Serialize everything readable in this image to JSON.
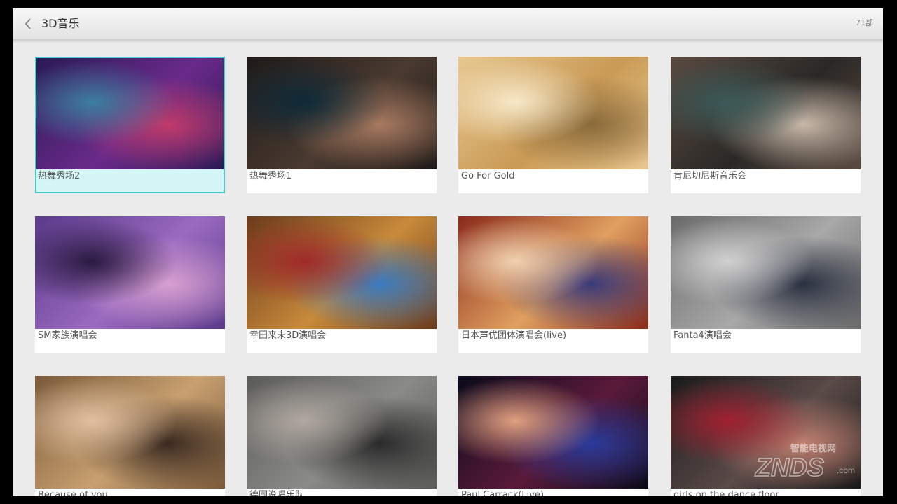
{
  "header": {
    "back_icon": "chevron-left-icon",
    "title": "3D音乐",
    "count": "71部"
  },
  "items": [
    {
      "caption": "热舞秀场2",
      "selected": true,
      "palette": [
        "#2a1a55",
        "#6a2a8a",
        "#c03a6a",
        "#3c7fa0"
      ]
    },
    {
      "caption": "热舞秀场1",
      "selected": false,
      "palette": [
        "#1e1a18",
        "#4a3a30",
        "#a87a60",
        "#0e2a38"
      ]
    },
    {
      "caption": "Go For Gold",
      "selected": false,
      "palette": [
        "#e8c890",
        "#c99a55",
        "#8a6a3a",
        "#f6e8c8"
      ]
    },
    {
      "caption": "肯尼切尼斯音乐会",
      "selected": false,
      "palette": [
        "#5a4a40",
        "#2a2826",
        "#c8b8a8",
        "#3a5a58"
      ]
    },
    {
      "caption": "SM家族演唱会",
      "selected": false,
      "palette": [
        "#5a3a8a",
        "#9a6ac0",
        "#d8a0d0",
        "#2a1a40"
      ]
    },
    {
      "caption": "幸田来未3D演唱会",
      "selected": false,
      "palette": [
        "#6a3a1a",
        "#c88a3a",
        "#3a7ac0",
        "#a02a2a"
      ]
    },
    {
      "caption": "日本声优团体演唱会(live)",
      "selected": false,
      "palette": [
        "#8a2a1a",
        "#e0a060",
        "#3a3a7a",
        "#f0d0b0"
      ]
    },
    {
      "caption": "Fanta4演唱会",
      "selected": false,
      "palette": [
        "#6a6a6a",
        "#a8a8a8",
        "#2a3040",
        "#d0d0d0"
      ]
    },
    {
      "caption": "Because of you",
      "selected": false,
      "palette": [
        "#7a5a3a",
        "#c8a070",
        "#3a2a20",
        "#e0c0a0"
      ]
    },
    {
      "caption": "德国说唱乐队",
      "selected": false,
      "palette": [
        "#5a5a58",
        "#8a8a88",
        "#2a2a2a",
        "#b0a8a0"
      ]
    },
    {
      "caption": "Paul Carrack(Live)",
      "selected": false,
      "palette": [
        "#0a0a1a",
        "#5a1a3a",
        "#2a3a9a",
        "#e0a080"
      ]
    },
    {
      "caption": "girls on the dance floor",
      "selected": false,
      "palette": [
        "#1a1a1a",
        "#5a4a48",
        "#c08070",
        "#a02030"
      ]
    }
  ],
  "watermark": {
    "brand_cn": "智能电视网",
    "brand_en": "ZNDS",
    "domain": ".com"
  }
}
